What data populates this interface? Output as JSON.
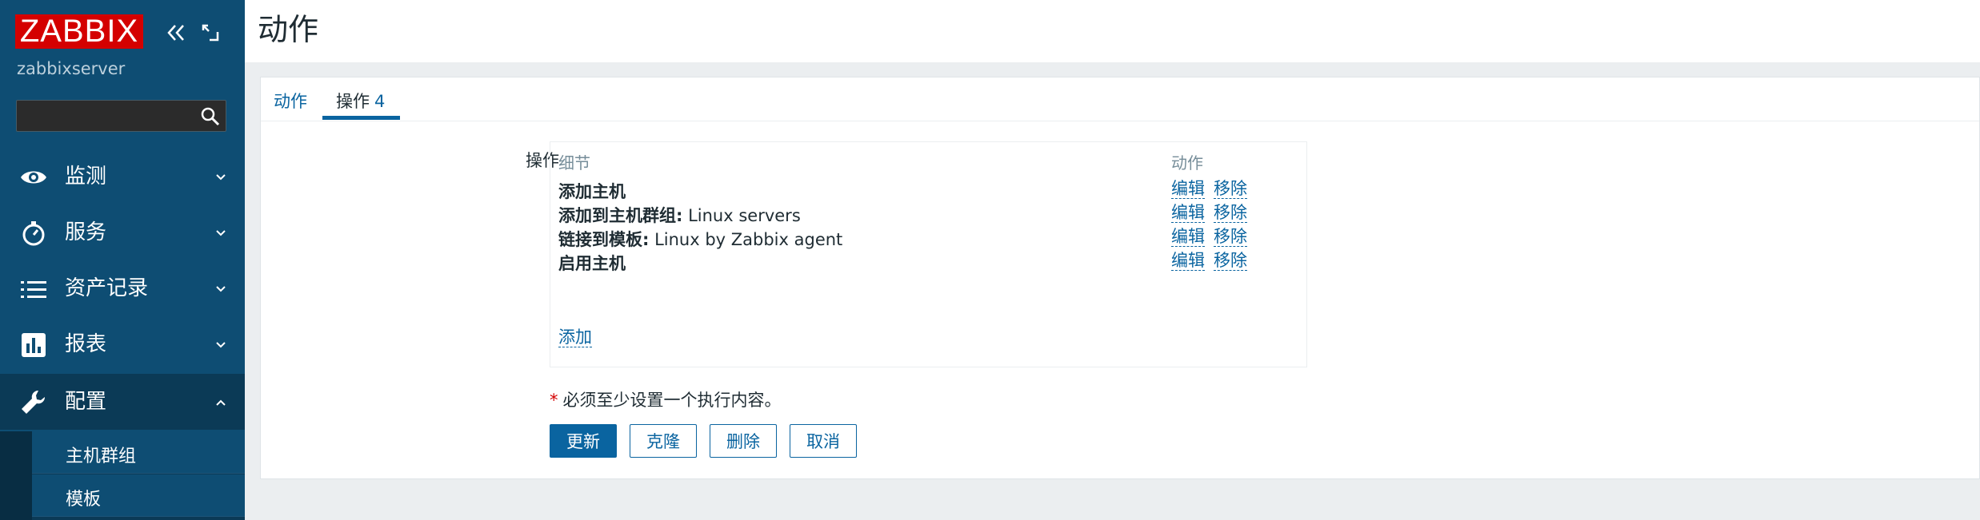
{
  "sidebar": {
    "logo": "ZABBIX",
    "server_name": "zabbixserver",
    "search": {
      "value": "",
      "placeholder": ""
    },
    "menu": [
      {
        "label": "监测",
        "icon": "eye-icon"
      },
      {
        "label": "服务",
        "icon": "stopwatch-icon"
      },
      {
        "label": "资产记录",
        "icon": "list-icon"
      },
      {
        "label": "报表",
        "icon": "bar-chart-icon"
      },
      {
        "label": "配置",
        "icon": "wrench-icon",
        "expanded": true
      }
    ],
    "submenu": [
      {
        "label": "主机群组"
      },
      {
        "label": "模板"
      }
    ]
  },
  "header": {
    "title": "动作"
  },
  "tabs": [
    {
      "label": "动作"
    },
    {
      "label": "操作",
      "count": "4",
      "active": true
    }
  ],
  "operations": {
    "label": "操作",
    "col_detail": "细节",
    "col_action": "动作",
    "rows": [
      {
        "bold": "添加主机",
        "rest": ""
      },
      {
        "bold": "添加到主机群组:",
        "rest": " Linux servers"
      },
      {
        "bold": "链接到模板:",
        "rest": " Linux by Zabbix agent"
      },
      {
        "bold": "启用主机",
        "rest": ""
      }
    ],
    "edit_label": "编辑",
    "remove_label": "移除",
    "add_label": "添加"
  },
  "required_note": {
    "star": "*",
    "text": "必须至少设置一个执行内容。"
  },
  "buttons": {
    "update": "更新",
    "clone": "克隆",
    "delete": "删除",
    "cancel": "取消"
  },
  "colors": {
    "sidebar": "#0e4d73",
    "sidebar_active": "#0b3a56",
    "logo": "#d40000",
    "link": "#0a64a0",
    "required": "#d40000"
  }
}
